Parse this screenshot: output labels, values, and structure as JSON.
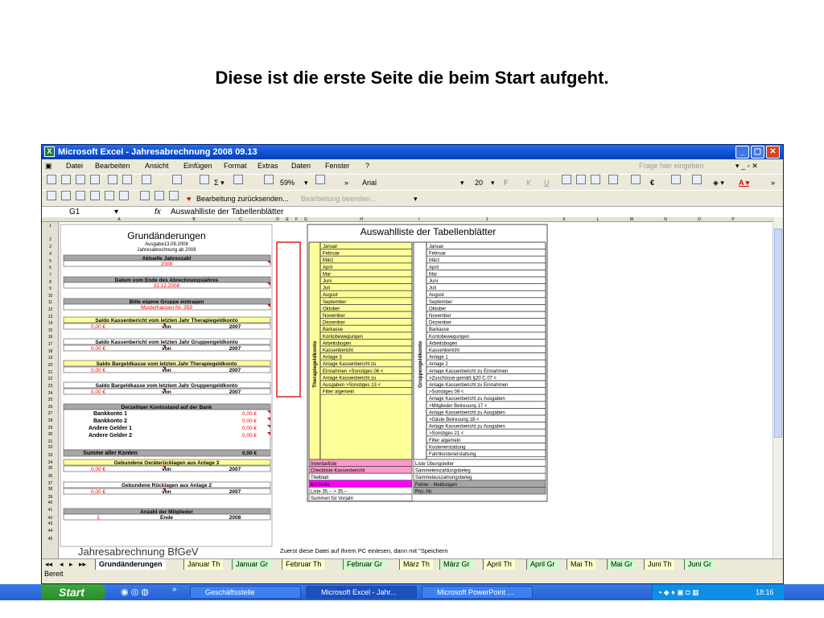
{
  "slide_title": "Diese ist die erste Seite die beim Start aufgeht.",
  "window": {
    "title": "Microsoft Excel - Jahresabrechnung 2008 09.13",
    "app_icon": "excel-icon"
  },
  "menu": {
    "items": [
      "Datei",
      "Bearbeiten",
      "Ansicht",
      "Einfügen",
      "Format",
      "Extras",
      "Daten",
      "Fenster",
      "?"
    ],
    "ask_placeholder": "Frage hier eingeben"
  },
  "toolbar": {
    "zoom": "59%",
    "font": "Arial",
    "size": "20",
    "reply_changes": "Bearbeitung zurücksenden...",
    "end_review": "Bearbeitung beenden..."
  },
  "formula_bar": {
    "name_box": "G1",
    "fx": "fx",
    "content": "Auswahlliste der Tabellenblätter"
  },
  "columns": [
    "A",
    "B",
    "C",
    "D",
    "E",
    "F",
    "G",
    "H",
    "I",
    "J",
    "K",
    "L",
    "M",
    "N",
    "O",
    "P"
  ],
  "rows": [
    "1",
    "2",
    "3",
    "4",
    "5",
    "6",
    "7",
    "8",
    "9",
    "10",
    "11",
    "12",
    "13",
    "14",
    "15",
    "16",
    "17",
    "18",
    "19",
    "20",
    "21",
    "22",
    "23",
    "24",
    "25",
    "26",
    "27",
    "28",
    "29",
    "30",
    "31",
    "32",
    "33",
    "34",
    "35",
    "36",
    "37",
    "38",
    "39",
    "40",
    "41",
    "42",
    "43",
    "44",
    "45"
  ],
  "left_panel": {
    "title": "Grundänderungen",
    "line1": "Ausgabe13.09.2008",
    "line2": "Jahresabrechnung  ab 2008",
    "sec1_head": "Aktuelle Jahreszahl",
    "sec1_val": "2008",
    "sec2_head": "Datum  vom Ende des Abrechnungsjahres",
    "sec2_val": "31.12.2008",
    "sec3_head": "Bitte eigene Gruppe eintragen",
    "sec3_val": "Musterhausen Nr. 359",
    "s4_head": "Saldo Kassenbericht vom letzten Jahr Therapiegeldkonto",
    "s4_val": "0,00 €",
    "s4_von": "von",
    "s4_year": "2007",
    "s5_head": "Saldo Kassenbericht vom letzten Jahr Gruppengeldkonto",
    "s5_val": "0,00 €",
    "s5_von": "von",
    "s5_year": "2007",
    "s6_head": "Saldo Bargeldkasse vom letzten Jahr Therapiegeldkonto",
    "s6_val": "0,00 €",
    "s6_von": "von",
    "s6_year": "2007",
    "s7_head": "Saldo Bargeldkasse vom letztem Jahr Gruppengeldkonto",
    "s7_val": "0,00 €",
    "s7_von": "von",
    "s7_year": "2007",
    "bank_head": "Derzeitiger Kontostand auf der Bank",
    "bank_rows": [
      {
        "label": "Bankkonto 1",
        "val": "0,00 €"
      },
      {
        "label": "Bankkonto 2",
        "val": "0,00 €"
      },
      {
        "label": "Andere Gelder 1",
        "val": "0,00 €"
      },
      {
        "label": "Andere Gelder 2",
        "val": "0,00 €"
      }
    ],
    "sum_label": "Summe aller Konten",
    "sum_val": "0,00 €",
    "r1_head": "Gebundene Geräterücklagen aus Anlage 3",
    "r1_val": "0,00 €",
    "r1_von": "von",
    "r1_year": "2007",
    "r2_head": "Gebundene Rücklagen aus Anlage 2",
    "r2_val": "0,00 €",
    "r2_von": "von",
    "r2_year": "2007",
    "mem_head": "Anzahl der Mitglieder",
    "mem_val": "1",
    "mem_ende": "Ende",
    "mem_year": "2008",
    "footer_big": "Jahresabrechnung BfGeV",
    "footer_note": "Zuerst diese Datei auf Ihrem PC einlesen, dann mit \"Speichern"
  },
  "right_panel": {
    "title": "Auswahlliste der Tabellenblätter",
    "left_vlabel": "Therapiegeldkonto",
    "right_vlabel": "Gruppengeldkonto",
    "left_items": [
      "Januar",
      "Februar",
      "März",
      "April",
      "Mai",
      "Juni",
      "Juli",
      "August",
      "September",
      "Oktober",
      "November",
      "Dezember",
      "Barkasse",
      "Kontobewegungen",
      "Arbeitsbogen",
      "Kassenbericht",
      "Anlage 3",
      "Anlage Kassenbericht zu",
      "Einnahmen >Sonstiges 06 <",
      "Anlage Kassenbericht zu",
      "Ausgaben >Sonstiges 13 <",
      "Filter algemein"
    ],
    "right_items": [
      "Januar",
      "Februar",
      "März",
      "April",
      "Mai",
      "Juni",
      "Juli",
      "August",
      "September",
      "Oktober",
      "November",
      "Dezember",
      "Barkasse",
      "Kontobewegungen",
      "Arbeitsbogen",
      "Kassenbericht",
      "Anlage 1",
      "Anlage 2",
      "Anlage Kassenbericht zu Einnahmen",
      ">Zuschüsse gemäß §20 C  07 <",
      "Anlage Kassenbericht zu Einnahmen",
      ">Sonstiges 09 <",
      "Anlage Kassenbericht zu Ausgaben",
      ">Mitglieder Betreuung 17 <",
      "Anlage Kassenbericht zu Ausgaben",
      ">Gäste Betreuung 18 <",
      "Anlage Kassenbericht zu Ausgaben",
      ">Sonstiges 21 <",
      "Filter algemein",
      "Kostenerstattung",
      "Fahrtkostenerstattung"
    ],
    "bottom_left": [
      "Inventarliste",
      "Checkliste Kassenbericht",
      "Titelblatt",
      "Kontrolle",
      "Liste 35,-- >  35,--",
      "Summen für Vorjahr"
    ],
    "bottom_right": [
      "Liste Übungsleiter",
      "Sammeleinzahlungsbeleg",
      "Sammelauszahlungsbeleg",
      "Fehler - Meldungen",
      "Pos.-Nr."
    ]
  },
  "sheet_tabs": [
    "Grundänderungen",
    "Januar Th",
    "Januar Gr",
    "Februar Th",
    "Februar Gr",
    "März Th",
    "März Gr",
    "April Th",
    "April Gr",
    "Mai Th",
    "Mai Gr",
    "Juni Th",
    "Juni Gr"
  ],
  "status": "Bereit",
  "taskbar": {
    "start": "Start",
    "tasks": [
      "Geschäftsstelle",
      "Microsoft Excel - Jahr...",
      "Microsoft PowerPoint ..."
    ],
    "clock": "18:16"
  },
  "colors": {
    "yellow_block": "#ffff99",
    "grey_header": "#a6a6a6",
    "red_value": "#ff0000",
    "pink": "#ff99cc",
    "magenta": "#ff00ff",
    "red_frame": "#d82020"
  }
}
